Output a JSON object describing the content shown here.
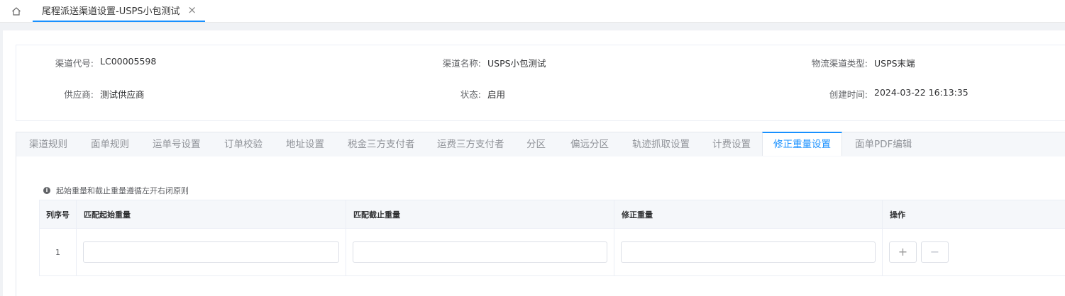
{
  "topbar": {
    "home_icon": "home-icon",
    "tab_title": "尾程派送渠道设置-USPS小包测试",
    "tab_close": "×"
  },
  "info": {
    "channel_code_label": "渠道代号:",
    "channel_code_value": "LC00005598",
    "channel_name_label": "渠道名称:",
    "channel_name_value": "USPS小包测试",
    "channel_type_label": "物流渠道类型:",
    "channel_type_value": "USPS末端",
    "supplier_label": "供应商:",
    "supplier_value": "测试供应商",
    "status_label": "状态:",
    "status_value": "启用",
    "created_label": "创建时间:",
    "created_value": "2024-03-22 16:13:35"
  },
  "tabs": [
    "渠道规则",
    "面单规则",
    "运单号设置",
    "订单校验",
    "地址设置",
    "税金三方支付者",
    "运费三方支付者",
    "分区",
    "偏远分区",
    "轨迹抓取设置",
    "计费设置",
    "修正重量设置",
    "面单PDF编辑"
  ],
  "active_tab": "修正重量设置",
  "tip": "起始重量和截止重量遵循左开右闭原则",
  "table": {
    "headers": [
      "列序号",
      "匹配起始重量",
      "匹配截止重量",
      "修正重量",
      "操作"
    ],
    "rows": [
      {
        "index": "1",
        "start_weight": "",
        "end_weight": "",
        "corrected_weight": ""
      }
    ],
    "add_symbol": "+",
    "remove_symbol": "−"
  },
  "colors": {
    "accent": "#1890ff",
    "border": "#ebeef5",
    "header_bg": "#f5f7fa",
    "page_bg": "#f0f2f5"
  }
}
